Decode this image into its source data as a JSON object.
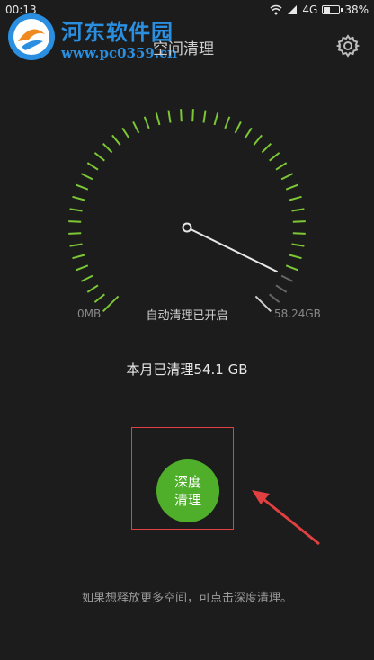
{
  "status_bar": {
    "time": "00:13",
    "network": "4G",
    "battery": "38%"
  },
  "watermark": {
    "title": "河东软件园",
    "url": "www.pc0359.cn"
  },
  "header": {
    "title": "空间清理"
  },
  "gauge": {
    "min_label": "0MB",
    "max_label": "58.24GB",
    "status": "自动清理已开启",
    "level": 0.93
  },
  "summary": {
    "cleaned": "本月已清理54.1 GB"
  },
  "deep_clean": {
    "label_line1": "深度",
    "label_line2": "清理"
  },
  "hint": "如果想释放更多空间，可点击深度清理。",
  "colors": {
    "background": "#1c1c1c",
    "tick_green": "#7cc734",
    "button_green": "#4fae2a",
    "annotation_red": "#e04040",
    "watermark_blue": "#2a8fe0"
  }
}
